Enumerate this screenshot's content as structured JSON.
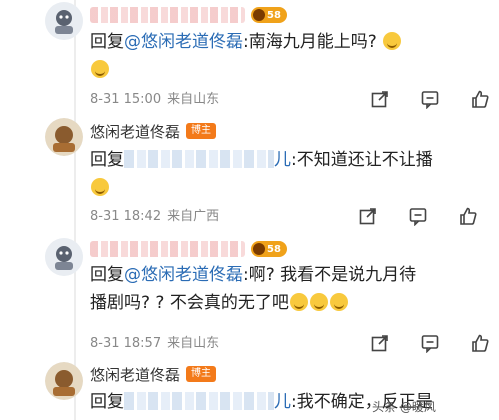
{
  "comments": [
    {
      "name_hidden": true,
      "level": "58",
      "text": {
        "reply_prefix": "回复",
        "mention": "@悠闲老道佟磊",
        "body": ":南海九月能上吗?"
      },
      "emojis_after_body": 2,
      "time": "8-31 15:00",
      "source": "来自山东"
    },
    {
      "name": "悠闲老道佟磊",
      "host_badge": "博主",
      "text": {
        "reply_prefix": "回复",
        "masked_name_suffix": "儿",
        "body": ":不知道还让不让播"
      },
      "emojis_after_body": 1,
      "time": "8-31 18:42",
      "source": "来自广西"
    },
    {
      "name_hidden": true,
      "level": "58",
      "text": {
        "reply_prefix": "回复",
        "mention": "@悠闲老道佟磊",
        "body_line1": ":啊? 我看不是说九月待",
        "body_line2": "播剧吗? ? 不会真的无了吧"
      },
      "emojis_after_body": 3,
      "time": "8-31 18:57",
      "source": "来自山东"
    },
    {
      "name": "悠闲老道佟磊",
      "host_badge": "博主",
      "text": {
        "reply_prefix": "回复",
        "masked_name_suffix": "儿",
        "body": ":我不确定，反正是"
      }
    }
  ],
  "icons": {
    "share": "share-icon",
    "comment": "comment-icon",
    "like": "like-icon"
  },
  "watermark": "头条 @暖风"
}
